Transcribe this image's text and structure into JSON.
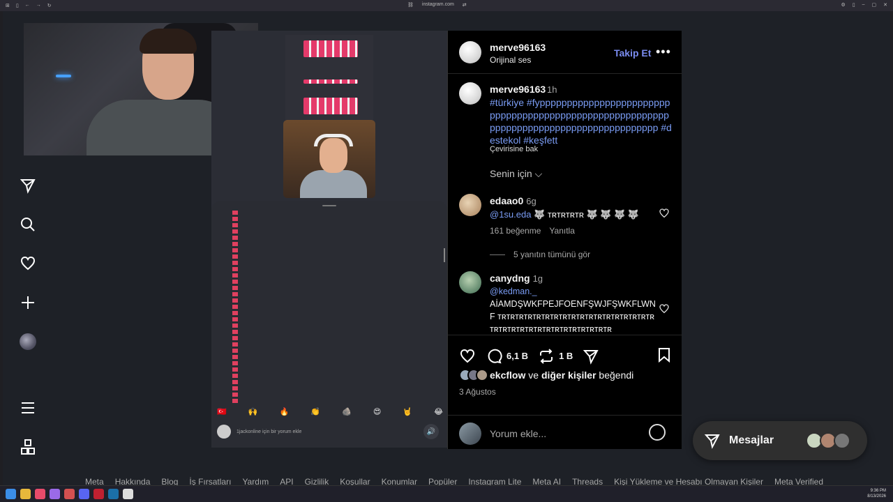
{
  "browser": {
    "url": "instagram.com"
  },
  "post": {
    "header": {
      "username": "merve96163",
      "subtitle": "Orijinal ses",
      "follow_label": "Takip Et",
      "more_label": "•••"
    },
    "caption": {
      "username": "merve96163",
      "time": "1h",
      "text": "#türkiye #fypppppppppppppppppppppppppppppppppppppppppppppppppppppppppppppppppppppppppppppppppppppppp #destekol #keşfett",
      "translate_label": "Çevirisine bak"
    },
    "filter_label": "Senin için",
    "comments": [
      {
        "username": "edaao0",
        "time": "6g",
        "mention": "@1su.eda",
        "text": "🐺 ᴛʀᴛʀᴛʀᴛʀ 🐺 🐺 🐺 🐺",
        "likes": "161 beğenme",
        "reply_label": "Yanıtla"
      },
      {
        "username": "canydng",
        "time": "1g",
        "mention": "@kedman._",
        "text": "AİAMDŞWKFPEJFOENFŞWJFŞWKFLWNF ᴛʀᴛʀᴛʀᴛʀᴛʀᴛʀᴛʀᴛʀᴛʀᴛʀᴛʀᴛʀᴛʀᴛʀᴛʀᴛʀᴛʀᴛʀᴛʀᴛʀᴛʀᴛʀᴛʀᴛʀᴛʀᴛʀᴛʀᴛʀᴛʀᴛʀᴛʀᴛʀ"
      }
    ],
    "replies_label": "5 yanıtın tümünü gör",
    "actions": {
      "comment_count": "6,1 B",
      "repost_count": "1 B"
    },
    "likes": {
      "user": "ekcflow",
      "and": "ve",
      "others": "diğer kişiler",
      "liked": "beğendi"
    },
    "date": "3 Ağustos",
    "add_comment_placeholder": "Yorum ekle..."
  },
  "reel": {
    "emojis": [
      "🇹🇷",
      "🙌",
      "🔥",
      "👏",
      "🪨",
      "😍",
      "🤘",
      "😂"
    ],
    "input_placeholder": "1jackonline için bir yorum ekle"
  },
  "messages": {
    "label": "Mesajlar"
  },
  "footer": {
    "links": [
      "Meta",
      "Hakkında",
      "Blog",
      "İş Fırsatları",
      "Yardım",
      "API",
      "Gizlilik",
      "Koşullar",
      "Konumlar",
      "Popüler",
      "Instagram Lite",
      "Meta AI",
      "Threads",
      "Kişi Yükleme ve Hesabı Olmayan Kişiler",
      "Meta Verified"
    ]
  },
  "taskbar": {
    "time": "9:36 PM",
    "date": "8/13/2026"
  },
  "colors": {
    "accent": "#7a8cf0",
    "link": "#7a9cf4",
    "background": "#1e2127",
    "panel": "#000000"
  }
}
